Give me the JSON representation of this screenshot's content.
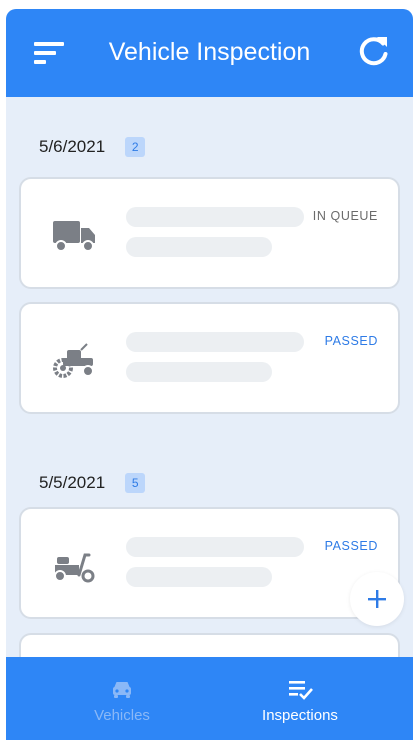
{
  "app": {
    "title": "Vehicle Inspection",
    "icons": {
      "menu": "sort-menu-icon",
      "refresh": "refresh-icon"
    }
  },
  "groups": [
    {
      "date": "5/6/2021",
      "count": "2",
      "cards": [
        {
          "vehicle_icon": "truck-icon",
          "status": "IN QUEUE"
        },
        {
          "vehicle_icon": "tractor-icon",
          "status": "PASSED"
        }
      ]
    },
    {
      "date": "5/5/2021",
      "count": "5",
      "cards": [
        {
          "vehicle_icon": "scooter-icon",
          "status": "PASSED"
        }
      ]
    }
  ],
  "fab": {
    "icon": "plus-icon"
  },
  "bottom_nav": {
    "vehicles": {
      "label": "Vehicles",
      "icon": "car-icon",
      "active": false
    },
    "inspections": {
      "label": "Inspections",
      "icon": "checklist-icon",
      "active": true
    }
  },
  "colors": {
    "primary": "#2e86f6",
    "background": "#e6eef9",
    "passed": "#2e7be6",
    "queue": "#6b6b6b",
    "inactive_nav": "#8ab8f7"
  }
}
